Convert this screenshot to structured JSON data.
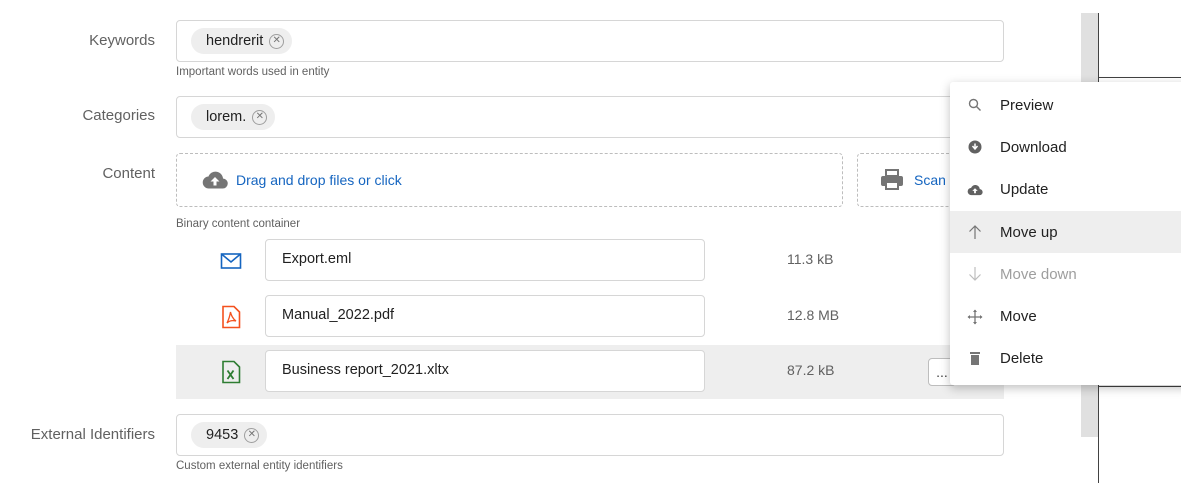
{
  "fields": {
    "keywords": {
      "label": "Keywords",
      "chip": "hendrerit",
      "hint": "Important words used in entity"
    },
    "categories": {
      "label": "Categories",
      "chip": "lorem."
    },
    "content": {
      "label": "Content",
      "drop_text": "Drag and drop files or click",
      "scan_text": "Scan",
      "hint": "Binary content container"
    },
    "external_ids": {
      "label": "External Identifiers",
      "chip": "9453",
      "hint": "Custom external entity identifiers"
    }
  },
  "files": [
    {
      "name": "Export.eml",
      "size": "11.3 kB",
      "icon": "email-icon",
      "color": "#1565c0"
    },
    {
      "name": "Manual_2022.pdf",
      "size": "12.8 MB",
      "icon": "pdf-icon",
      "color": "#f4511e"
    },
    {
      "name": "Business report_2021.xltx",
      "size": "87.2 kB",
      "icon": "excel-icon",
      "color": "#2e7d32",
      "more": "..."
    }
  ],
  "menu": {
    "items": [
      {
        "label": "Preview",
        "icon": "search-icon"
      },
      {
        "label": "Download",
        "icon": "download-icon"
      },
      {
        "label": "Update",
        "icon": "cloud-upload-icon"
      },
      {
        "label": "Move up",
        "icon": "arrow-up-icon",
        "state": "hover"
      },
      {
        "label": "Move down",
        "icon": "arrow-down-icon",
        "state": "disabled"
      },
      {
        "label": "Move",
        "icon": "move-icon"
      },
      {
        "label": "Delete",
        "icon": "trash-icon"
      }
    ]
  }
}
